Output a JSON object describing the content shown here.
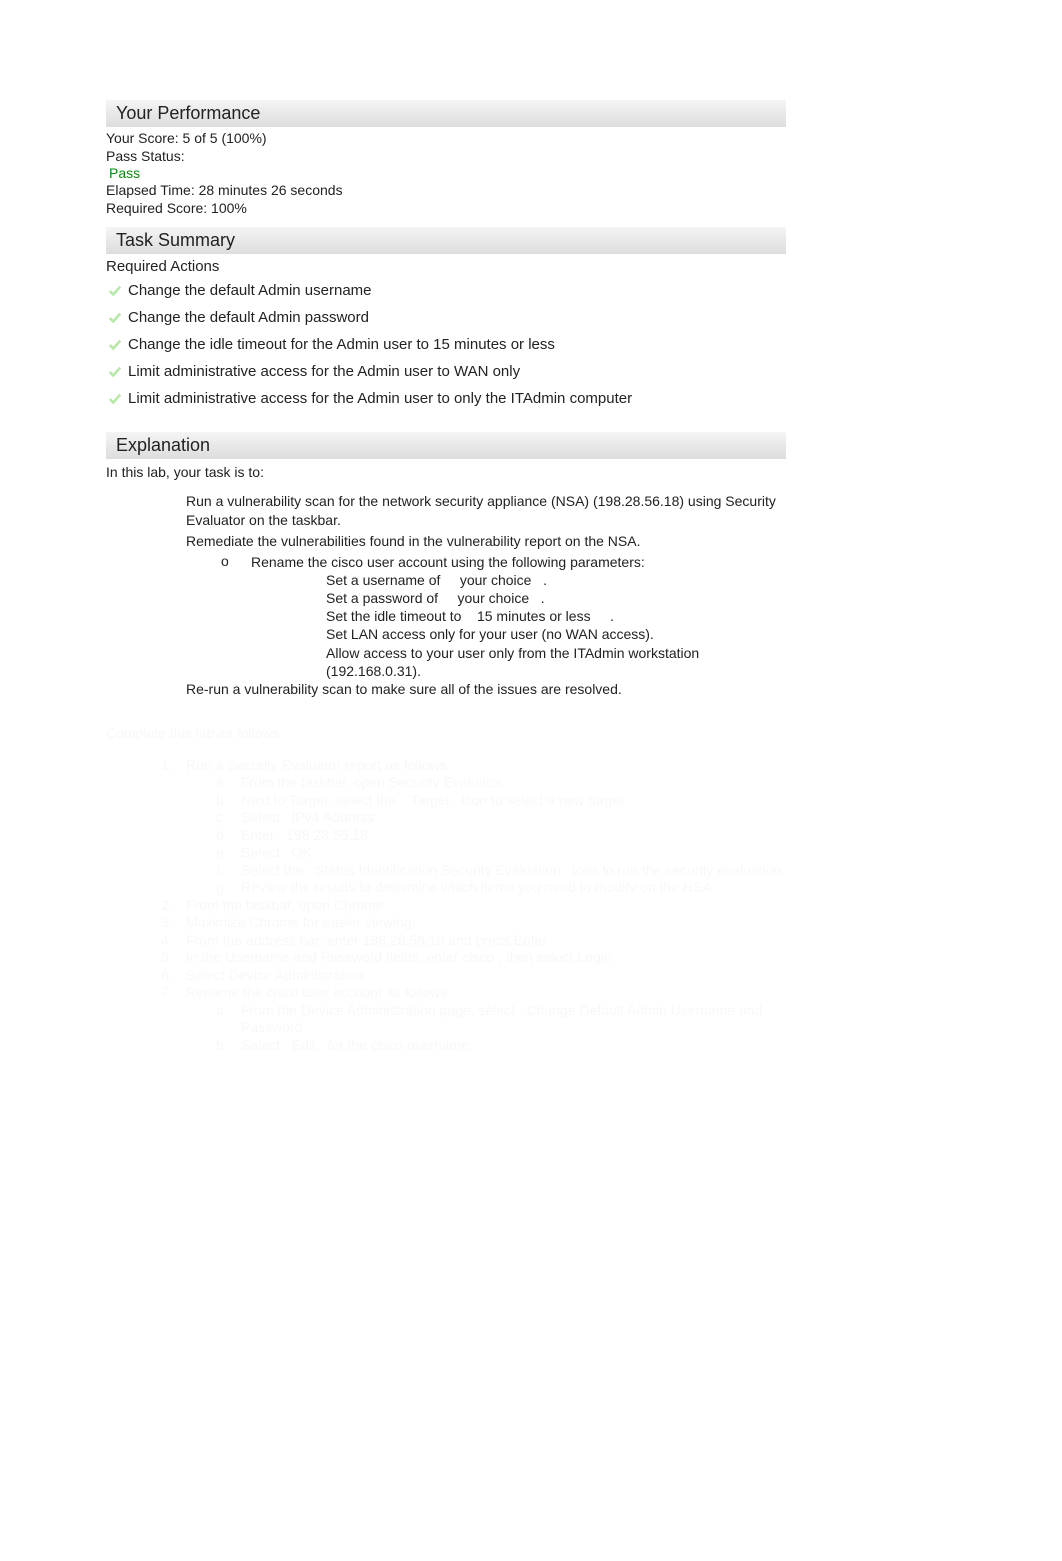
{
  "performance": {
    "heading": "Your Performance",
    "score": "Your Score: 5 of 5 (100%)",
    "pass_label": "Pass Status:",
    "pass_status": "Pass",
    "elapsed": "Elapsed Time: 28 minutes 26 seconds",
    "required": "Required Score: 100%"
  },
  "task_summary": {
    "heading": "Task Summary",
    "required_label": "Required Actions",
    "actions": [
      "Change the default Admin username",
      "Change the default Admin password",
      "Change the idle timeout for the Admin user to 15 minutes or less",
      "Limit administrative access for the Admin user to WAN only",
      "Limit administrative access for the Admin user to only the ITAdmin computer"
    ]
  },
  "explanation": {
    "heading": "Explanation",
    "intro": "In this lab, your task is to:",
    "bullets": [
      "Run a vulnerability scan for the network security appliance (NSA) (198.28.56.18) using Security Evaluator on the taskbar.",
      "Remediate the vulnerabilities found in the vulnerability report on the NSA."
    ],
    "sub_o": "Rename the cisco user account using the following parameters:",
    "sub_items": [
      "Set a username of     your choice   .",
      "Set a password of     your choice   .",
      "Set the idle timeout to    15 minutes or less     .",
      "Set LAN access only for your user (no WAN access).",
      "Allow access to your user only from the ITAdmin workstation (192.168.0.31)."
    ],
    "rerun": "Re-run a vulnerability scan to make sure all of the issues are resolved."
  },
  "faded": {
    "header": "Complete this lab as follows:",
    "items": [
      {
        "num": "1.",
        "text": "Run a Security Evaluator report as follows:",
        "sub": [
          {
            "l": "a.",
            "t": "From the taskbar, open Security Evaluator."
          },
          {
            "l": "b.",
            "t": "Next to Target, select the    Target   icon to select a new target."
          },
          {
            "l": "c.",
            "t": "Select   IPv4 Address  ."
          },
          {
            "l": "d.",
            "t": "Enter   198.28.56.18  ."
          },
          {
            "l": "e.",
            "t": "Select   OK  ."
          },
          {
            "l": "f.",
            "t": "Select the   Status Identification Security Evaluation   icon to run the security evaluation."
          },
          {
            "l": "g.",
            "t": "Review the results to determine which items you need to modify on the NSA."
          }
        ]
      },
      {
        "num": "2.",
        "text": "From the taskbar, open Chrome."
      },
      {
        "num": "3.",
        "text": "Maximize Chrome for easier viewing."
      },
      {
        "num": "4.",
        "text": "From the address bar, enter   198.28.56.18   and press   Enter  ."
      },
      {
        "num": "5.",
        "text": "In the Username and Password fields, enter   cisco  ; then select   Login  ."
      },
      {
        "num": "6.",
        "text": "Select   Device Administration   ."
      },
      {
        "num": "7.",
        "text": "Rename the cisco user account as follows:",
        "sub": [
          {
            "l": "a.",
            "t": "From the Device Administration page, select   Change Default Admin Username and Password  ."
          },
          {
            "l": "b.",
            "t": "Select   Edit   for the cisco username."
          }
        ]
      }
    ]
  }
}
